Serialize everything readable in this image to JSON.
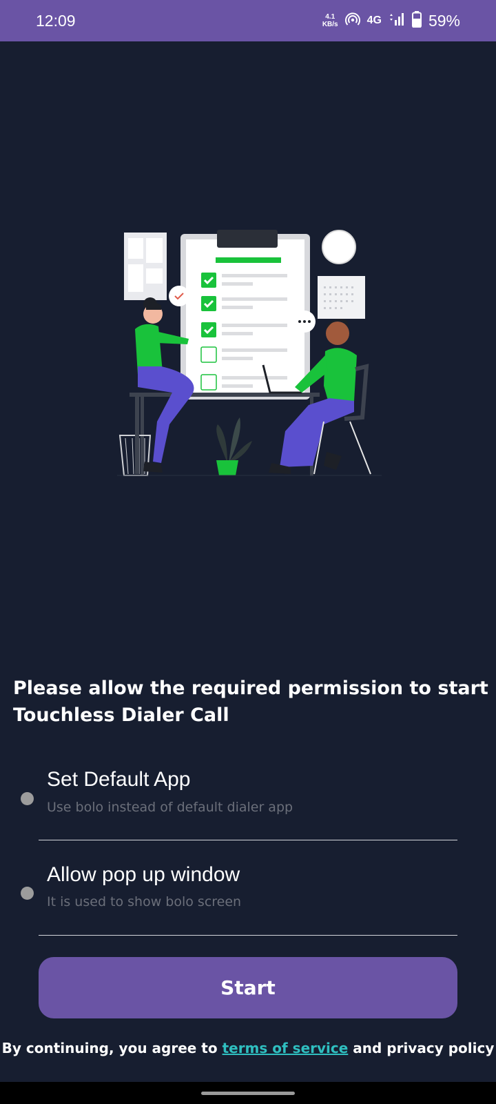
{
  "status_bar": {
    "time": "12:09",
    "net_speed_value": "4.1",
    "net_speed_unit": "KB/s",
    "network_type": "4G",
    "battery_percent": "59%",
    "icons": [
      "hotspot-icon",
      "signal-icon",
      "battery-icon"
    ]
  },
  "heading": "Please allow the required permission to start Touchless Dialer Call",
  "permissions": [
    {
      "title": "Set Default App",
      "subtitle": "Use bolo instead of default dialer app"
    },
    {
      "title": "Allow pop up window",
      "subtitle": "It is used to show bolo screen"
    }
  ],
  "start_button": {
    "label": "Start"
  },
  "footer": {
    "prefix": "By continuing, you agree to ",
    "link": "terms of service",
    "suffix": " and privacy policy"
  },
  "colors": {
    "background": "#171e30",
    "accent": "#6a54a5",
    "link": "#2fbfc0",
    "subtitle": "#6b6f7a"
  }
}
